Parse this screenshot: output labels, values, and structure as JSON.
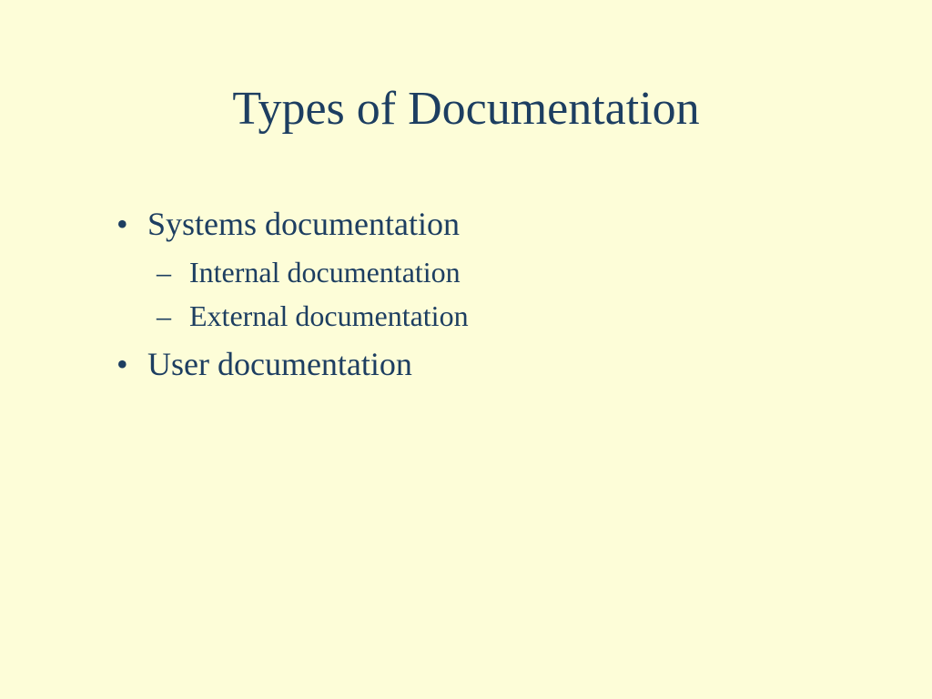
{
  "slide": {
    "title": "Types of Documentation",
    "bullets": [
      {
        "text": "Systems documentation",
        "subitems": [
          "Internal documentation",
          "External documentation"
        ]
      },
      {
        "text": "User documentation",
        "subitems": []
      }
    ]
  }
}
